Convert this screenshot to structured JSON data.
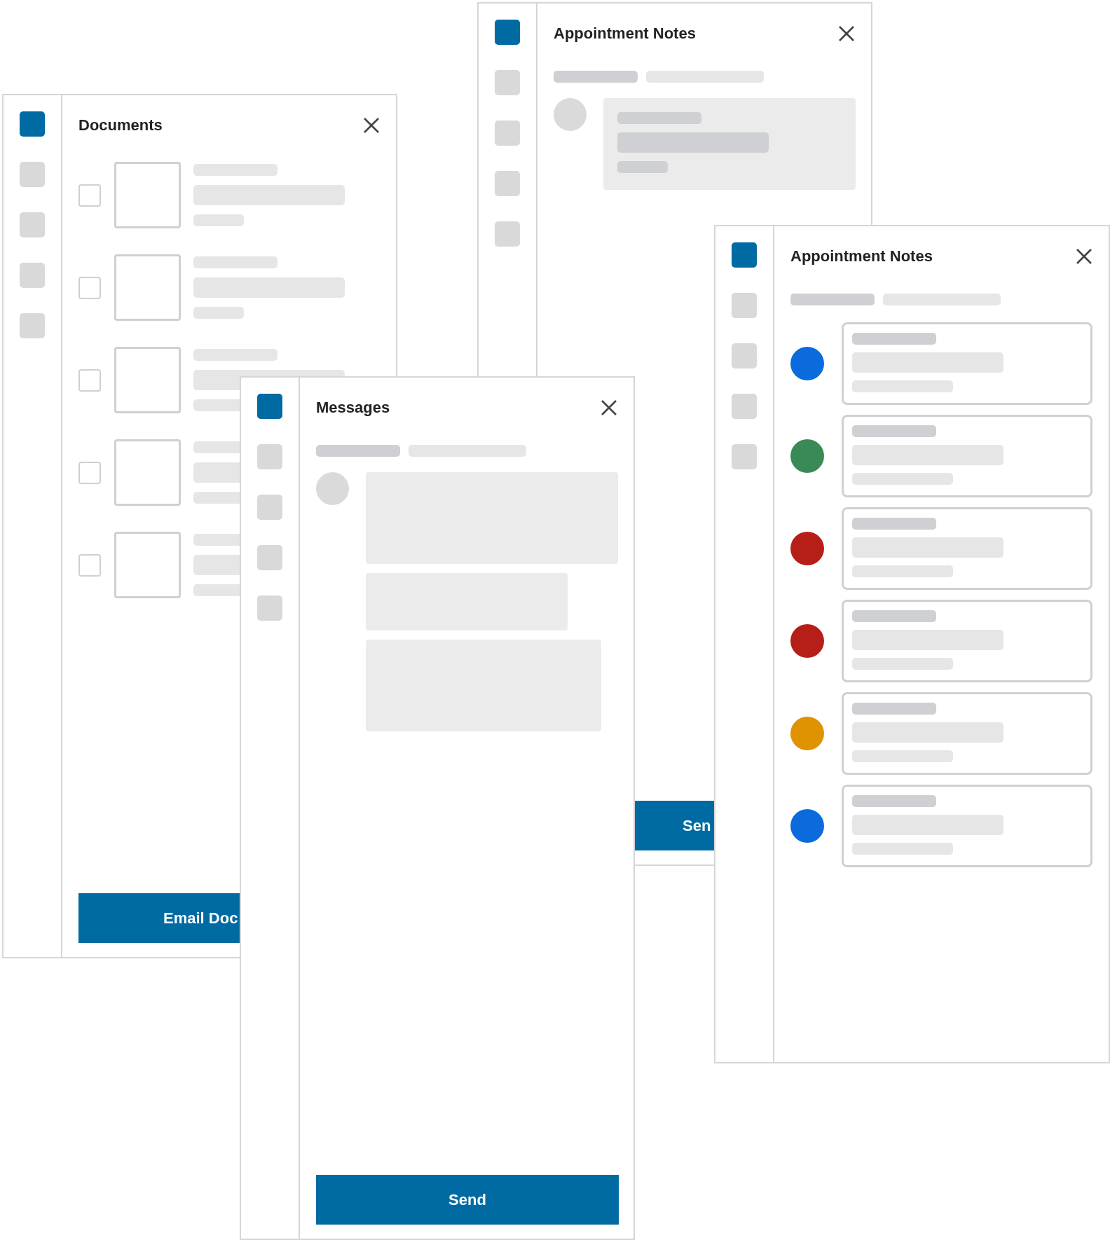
{
  "windows": [
    {
      "kind": "documents",
      "title": "Documents",
      "nav": [
        {
          "selected": true
        },
        {
          "selected": false
        },
        {
          "selected": false
        },
        {
          "selected": false
        },
        {
          "selected": false
        }
      ],
      "items": [
        {
          "checked": false
        },
        {
          "checked": false
        },
        {
          "checked": false
        },
        {
          "checked": false
        },
        {
          "checked": false
        }
      ],
      "button": "Email Doc"
    },
    {
      "kind": "message",
      "title": "Appointment Notes",
      "nav": [
        {
          "selected": true
        },
        {
          "selected": false
        },
        {
          "selected": false
        },
        {
          "selected": false
        },
        {
          "selected": false
        }
      ],
      "bubbles": [
        {
          "kind": "text"
        }
      ],
      "button": "Sen"
    },
    {
      "kind": "message",
      "title": "Messages",
      "nav": [
        {
          "selected": true
        },
        {
          "selected": false
        },
        {
          "selected": false
        },
        {
          "selected": false
        },
        {
          "selected": false
        }
      ],
      "bubbles": [
        {
          "kind": "large"
        },
        {
          "kind": "medium"
        },
        {
          "kind": "wide"
        }
      ],
      "button": "Send"
    },
    {
      "kind": "notes",
      "title": "Appointment Notes",
      "nav": [
        {
          "selected": true
        },
        {
          "selected": false
        },
        {
          "selected": false
        },
        {
          "selected": false
        },
        {
          "selected": false
        }
      ],
      "items": [
        {
          "color": "#0b6bdc"
        },
        {
          "color": "#3a8a55"
        },
        {
          "color": "#b61f17"
        },
        {
          "color": "#b61f17"
        },
        {
          "color": "#e09300"
        },
        {
          "color": "#0b6bdc"
        }
      ]
    }
  ]
}
